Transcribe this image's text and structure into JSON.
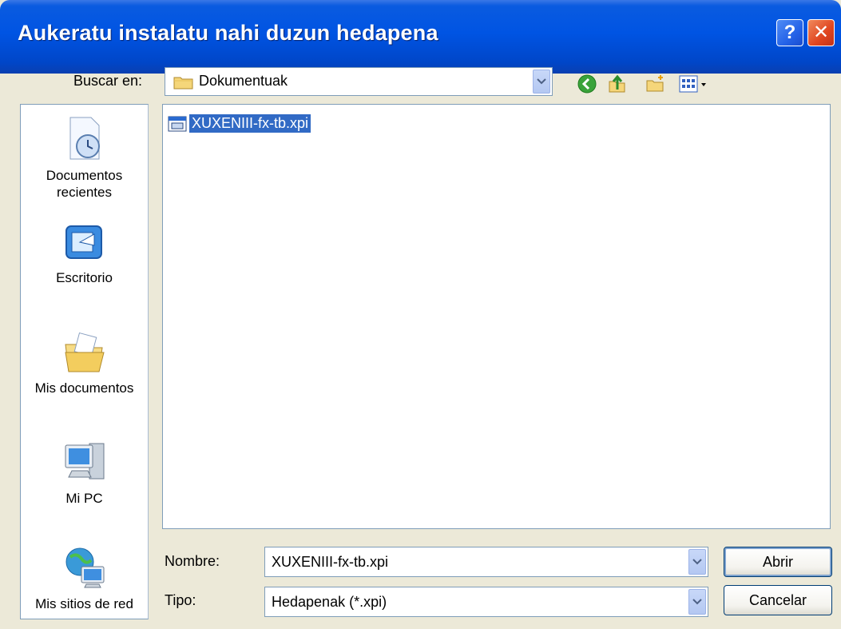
{
  "window": {
    "title": "Aukeratu instalatu nahi duzun hedapena",
    "help_label": "?",
    "close_label": "✕"
  },
  "lookin": {
    "label": "Buscar en:",
    "value": "Dokumentuak"
  },
  "toolbar": {
    "icons": [
      "back-icon",
      "up-folder-icon",
      "new-folder-icon",
      "views-menu-icon"
    ]
  },
  "places": {
    "items": [
      {
        "label": "Documentos recientes",
        "icon": "recent-documents-icon"
      },
      {
        "label": "Escritorio",
        "icon": "desktop-icon"
      },
      {
        "label": "Mis documentos",
        "icon": "my-documents-icon"
      },
      {
        "label": "Mi PC",
        "icon": "my-computer-icon"
      },
      {
        "label": "Mis sitios de red",
        "icon": "network-places-icon"
      }
    ]
  },
  "files": [
    {
      "name": "XUXENIII-fx-tb.xpi",
      "selected": true
    }
  ],
  "filename": {
    "label": "Nombre:",
    "value": "XUXENIII-fx-tb.xpi"
  },
  "filetype": {
    "label": "Tipo:",
    "value": "Hedapenak (*.xpi)"
  },
  "buttons": {
    "open": "Abrir",
    "cancel": "Cancelar"
  },
  "colors": {
    "titlebar": "#0054e3",
    "selection": "#316ac5",
    "dialog_bg": "#ece9d8"
  }
}
